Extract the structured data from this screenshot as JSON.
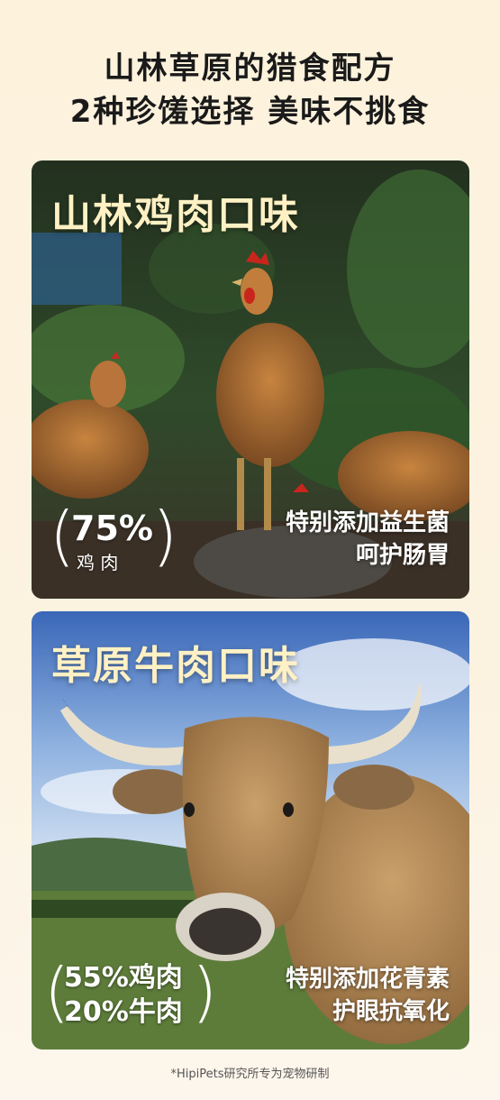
{
  "header": {
    "line1": "山林草原的猎食配方",
    "line2": "2种珍馐选择  美味不挑食"
  },
  "cards": [
    {
      "title": "山林鸡肉口味",
      "percent": "75%",
      "percent_label": "鸡    肉",
      "benefit_line1": "特别添加益生菌",
      "benefit_line2": "呵护肠胃"
    },
    {
      "title": "草原牛肉口味",
      "content_line1": "55%鸡肉",
      "content_line2": "20%牛肉",
      "benefit_line1": "特别添加花青素",
      "benefit_line2": "护眼抗氧化"
    }
  ],
  "footnote": "*HipiPets研究所专为宠物研制",
  "colors": {
    "title_text": "#fff1c4",
    "background": "#fdf2dc"
  }
}
